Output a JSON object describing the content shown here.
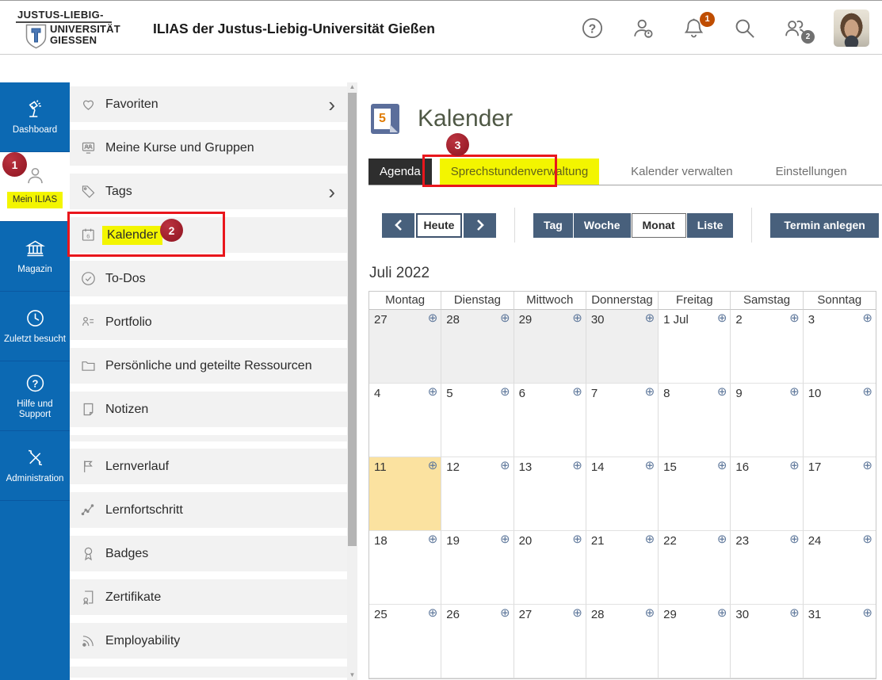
{
  "header": {
    "logo": {
      "line1": "JUSTUS-LIEBIG-",
      "line2": "UNIVERSITÄT",
      "line3": "GIESSEN"
    },
    "title": "ILIAS der Justus-Liebig-Universität Gießen",
    "bell_badge": "1",
    "online_badge": "2"
  },
  "sidebar": {
    "items": [
      {
        "label": "Dashboard",
        "icon": "lamp-icon"
      },
      {
        "label": "Mein ILIAS",
        "icon": "person-icon",
        "active": true,
        "highlighted": true
      },
      {
        "label": "Magazin",
        "icon": "building-icon"
      },
      {
        "label": "Zuletzt besucht",
        "icon": "clock-icon"
      },
      {
        "label": "Hilfe und Support",
        "icon": "help-icon"
      },
      {
        "label": "Administration",
        "icon": "tools-icon"
      }
    ]
  },
  "menu": {
    "items": [
      {
        "label": "Favoriten",
        "icon": "heart-icon",
        "chevron": true
      },
      {
        "label": "Meine Kurse und Gruppen",
        "icon": "courses-icon"
      },
      {
        "label": "Tags",
        "icon": "tag-icon",
        "chevron": true
      },
      {
        "label": "Kalender",
        "icon": "calendar-icon",
        "highlighted": true
      },
      {
        "label": "To-Dos",
        "icon": "todo-icon"
      },
      {
        "label": "Portfolio",
        "icon": "portfolio-icon"
      },
      {
        "label": "Persönliche und geteilte Ressourcen",
        "icon": "folder-icon"
      },
      {
        "label": "Notizen",
        "icon": "note-icon"
      },
      {
        "divider": true
      },
      {
        "label": "Lernverlauf",
        "icon": "flag-icon"
      },
      {
        "label": "Lernfortschritt",
        "icon": "progress-icon"
      },
      {
        "label": "Badges",
        "icon": "badge-icon"
      },
      {
        "label": "Zertifikate",
        "icon": "certificate-icon"
      },
      {
        "label": "Employability",
        "icon": "feed-icon"
      },
      {
        "partial": true
      }
    ]
  },
  "annotations": {
    "step1": "1",
    "step2": "2",
    "step3": "3"
  },
  "main": {
    "page_title": "Kalender",
    "tabs": [
      {
        "label": "Agenda",
        "active": true
      },
      {
        "label": "Sprechstundenverwaltung",
        "highlighted": true
      },
      {
        "label": "Kalender verwalten"
      },
      {
        "label": "Einstellungen"
      }
    ],
    "toolbar": {
      "today_label": "Heute",
      "views": [
        "Tag",
        "Woche",
        "Monat",
        "Liste"
      ],
      "active_view": "Monat",
      "create_label": "Termin anlegen"
    },
    "calendar": {
      "month_label": "Juli 2022",
      "weekdays": [
        "Montag",
        "Dienstag",
        "Mittwoch",
        "Donnerstag",
        "Freitag",
        "Samstag",
        "Sonntag"
      ],
      "weeks": [
        [
          {
            "day": "27",
            "muted": true
          },
          {
            "day": "28",
            "muted": true
          },
          {
            "day": "29",
            "muted": true
          },
          {
            "day": "30",
            "muted": true
          },
          {
            "day": "1 Jul"
          },
          {
            "day": "2"
          },
          {
            "day": "3"
          }
        ],
        [
          {
            "day": "4"
          },
          {
            "day": "5"
          },
          {
            "day": "6"
          },
          {
            "day": "7"
          },
          {
            "day": "8"
          },
          {
            "day": "9"
          },
          {
            "day": "10"
          }
        ],
        [
          {
            "day": "11",
            "today": true
          },
          {
            "day": "12"
          },
          {
            "day": "13"
          },
          {
            "day": "14"
          },
          {
            "day": "15"
          },
          {
            "day": "16"
          },
          {
            "day": "17"
          }
        ],
        [
          {
            "day": "18"
          },
          {
            "day": "19"
          },
          {
            "day": "20"
          },
          {
            "day": "21"
          },
          {
            "day": "22"
          },
          {
            "day": "23"
          },
          {
            "day": "24"
          }
        ],
        [
          {
            "day": "25"
          },
          {
            "day": "26"
          },
          {
            "day": "27"
          },
          {
            "day": "28"
          },
          {
            "day": "29"
          },
          {
            "day": "30"
          },
          {
            "day": "31"
          }
        ]
      ]
    }
  },
  "icons": {
    "add_appointment": "⊕",
    "chevron_right": "›"
  },
  "colors": {
    "sidebar_blue": "#0c69b3",
    "button_slate": "#48607c",
    "highlight_yellow": "#f3f500",
    "annotation_red": "#9e1b26",
    "box_red": "#e9161c",
    "today_yellow": "#fbe2a0",
    "bell_badge_orange": "#bf4d00",
    "active_tab_dark": "#2e2e2e"
  }
}
